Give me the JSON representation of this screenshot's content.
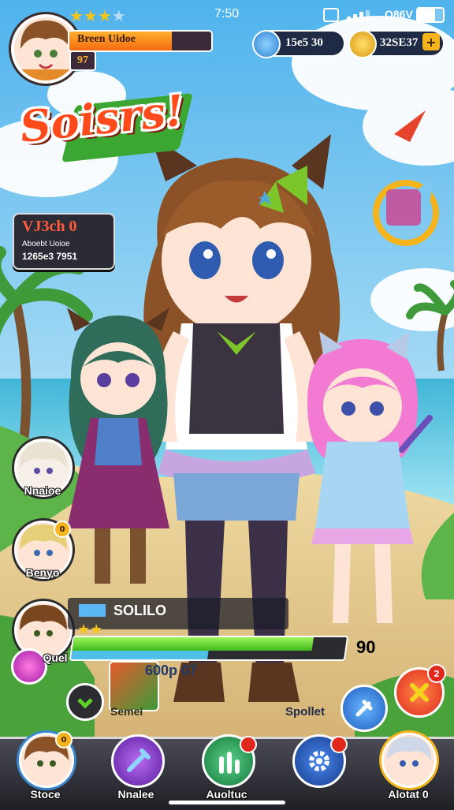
{
  "status_bar": {
    "time": "7:50",
    "carrier": "O86V"
  },
  "player": {
    "name": "Breen Uidoe",
    "level": "97",
    "stars_filled": 3,
    "stars_total": 4,
    "xp_fraction": 0.72
  },
  "currencies": [
    {
      "icon": "gem-icon",
      "value": "15e5 30"
    },
    {
      "icon": "coin-icon",
      "value": "32SE37"
    }
  ],
  "banner": {
    "title": "Soisrs!"
  },
  "event_panel": {
    "title": "VJ3ch 0",
    "line1": "Aboebt Uoioe",
    "line2": "1265e3 7951"
  },
  "side_party": [
    {
      "name": "Nnaioe"
    },
    {
      "name": "Benyo"
    },
    {
      "name": "Quel"
    }
  ],
  "active_hero": {
    "name": "SOLILO",
    "stars": 2,
    "hp_fraction": 0.88,
    "hp_value": "90",
    "power_text": "600p 07"
  },
  "actions": {
    "left_label": "Semei",
    "right_label": "Spollet",
    "close_badge": "2"
  },
  "bottom_nav": [
    {
      "label": "Stoce",
      "icon": "hero-portrait-icon",
      "badge": "0"
    },
    {
      "label": "Nnalee",
      "icon": "sword-icon",
      "badge": ""
    },
    {
      "label": "Auoltuc",
      "icon": "upgrade-arrow-icon",
      "badge": ""
    },
    {
      "label": "",
      "icon": "gear-icon",
      "badge": ""
    },
    {
      "label": "Alotat 0",
      "icon": "hero-portrait-icon-2",
      "badge": ""
    }
  ],
  "colors": {
    "sky": "#7fc8f0",
    "grass": "#5db54a",
    "sand": "#e8d49a",
    "hp_green": "#4fd12a",
    "xp_orange": "#f38b1c",
    "accent_red": "#e53a2c"
  }
}
